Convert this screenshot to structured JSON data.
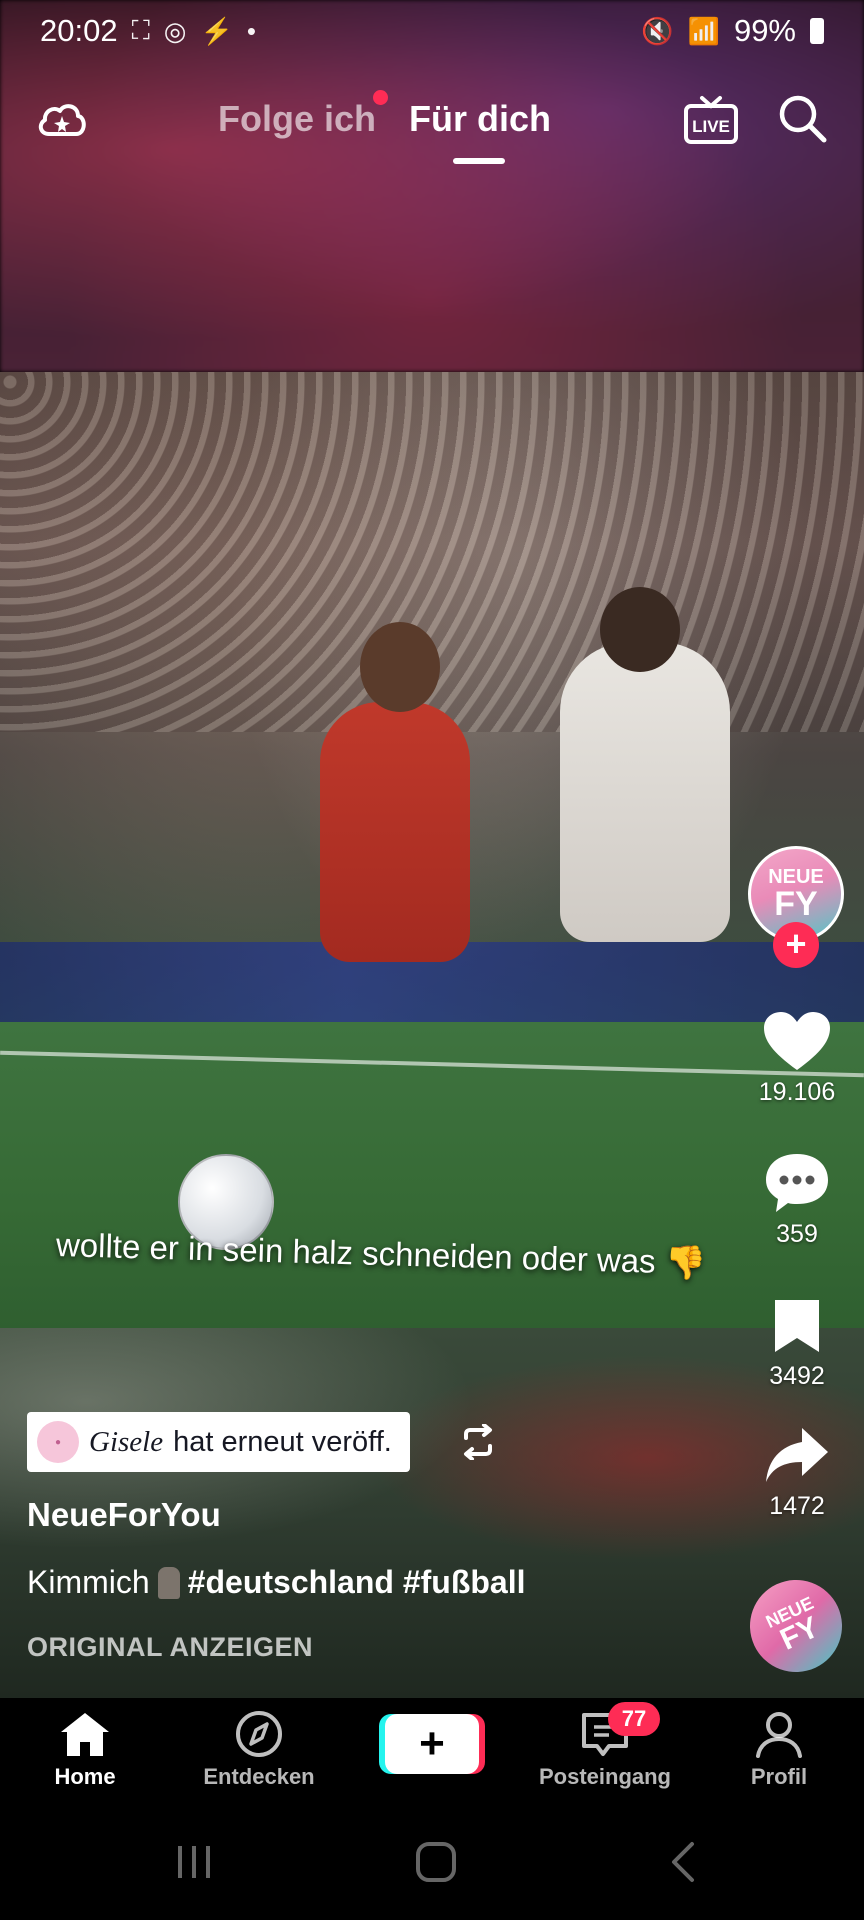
{
  "status_bar": {
    "time": "20:02",
    "battery": "99%",
    "left_icons": [
      "screenshot-icon",
      "whatsapp-icon",
      "signal-bolt-icon",
      "dot-icon"
    ],
    "right_icons": [
      "mute-icon",
      "wifi-icon",
      "cell-signal-icon",
      "battery-icon"
    ]
  },
  "top_nav": {
    "tab_following": "Folge ich",
    "tab_for_you": "Für dich",
    "live_label": "LIVE",
    "active_tab": "Für dich"
  },
  "video": {
    "caption": "wollte er in sein halz schneiden oder was 👎"
  },
  "right_rail": {
    "avatar_text_top": "NEUE",
    "avatar_text_bottom": "FY",
    "likes": "19.106",
    "comments": "359",
    "saves": "3492",
    "shares": "1472",
    "music_disc_top": "NEUE",
    "music_disc_bottom": "FY"
  },
  "post": {
    "repost_user": "Gisele",
    "repost_text": "hat erneut veröff.",
    "author": "NeueForYou",
    "description_prefix": "Kimmich",
    "hashtags": "#deutschland #fußball",
    "original_link": "ORIGINAL ANZEIGEN"
  },
  "bottom_nav": {
    "home": "Home",
    "discover": "Entdecken",
    "create": "+",
    "inbox": "Posteingang",
    "inbox_badge": "77",
    "profile": "Profil"
  },
  "colors": {
    "accent_red": "#fe2c55",
    "accent_cyan": "#25f4ee"
  }
}
